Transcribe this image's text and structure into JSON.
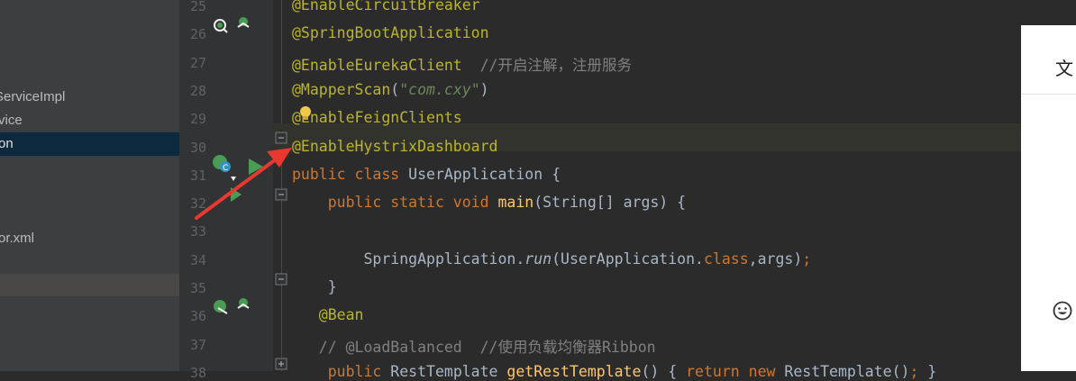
{
  "project_tree": {
    "items": [
      {
        "label": "ServiceImpl",
        "selected": false
      },
      {
        "label": "vice",
        "selected": false
      },
      {
        "label": "on",
        "selected": true
      },
      {
        "label": "or.xml",
        "selected": false
      },
      {
        "label": "",
        "selected": false,
        "highlight": true
      }
    ]
  },
  "editor": {
    "lines": [
      {
        "num": "25",
        "tokens": [
          {
            "t": "@EnableCircuitBreaker",
            "c": "ann"
          }
        ]
      },
      {
        "num": "26",
        "tokens": [
          {
            "t": "@SpringBootApplication",
            "c": "ann"
          }
        ]
      },
      {
        "num": "27",
        "tokens": [
          {
            "t": "@EnableEurekaClient",
            "c": "ann"
          },
          {
            "t": "  //开启注解，注册服务",
            "c": "cmt"
          }
        ]
      },
      {
        "num": "28",
        "tokens": [
          {
            "t": "@MapperScan",
            "c": "ann"
          },
          {
            "t": "(",
            "c": "plain"
          },
          {
            "t": "\"com.cxy\"",
            "c": "str"
          },
          {
            "t": ")",
            "c": "plain"
          }
        ]
      },
      {
        "num": "29",
        "tokens": [
          {
            "t": "@EnableFeignClients",
            "c": "ann"
          }
        ]
      },
      {
        "num": "30",
        "tokens": [
          {
            "t": "@EnableHystrixDashboard",
            "c": "ann"
          }
        ]
      },
      {
        "num": "31",
        "tokens": [
          {
            "t": "public class ",
            "c": "kw"
          },
          {
            "t": "UserApplication {",
            "c": "plain"
          }
        ]
      },
      {
        "num": "32",
        "tokens": [
          {
            "t": "    public static void ",
            "c": "kw"
          },
          {
            "t": "main",
            "c": "method"
          },
          {
            "t": "(String[] args) {",
            "c": "plain"
          }
        ]
      },
      {
        "num": "33",
        "tokens": []
      },
      {
        "num": "34",
        "tokens": [
          {
            "t": "        SpringApplication.",
            "c": "plain"
          },
          {
            "t": "run",
            "c": "italic"
          },
          {
            "t": "(UserApplication.",
            "c": "plain"
          },
          {
            "t": "class",
            "c": "kw"
          },
          {
            "t": ",args)",
            "c": "plain"
          },
          {
            "t": ";",
            "c": "kw"
          }
        ]
      },
      {
        "num": "35",
        "tokens": [
          {
            "t": "    }",
            "c": "plain"
          }
        ]
      },
      {
        "num": "36",
        "tokens": [
          {
            "t": "   @Bean",
            "c": "ann"
          }
        ]
      },
      {
        "num": "37",
        "tokens": [
          {
            "t": "   // @LoadBalanced  //使用负载均衡器Ribbon",
            "c": "cmt"
          }
        ]
      },
      {
        "num": "38",
        "tokens": [
          {
            "t": "    public ",
            "c": "kw"
          },
          {
            "t": "RestTemplate ",
            "c": "plain"
          },
          {
            "t": "getRestTemplate",
            "c": "method"
          },
          {
            "t": "() { ",
            "c": "plain"
          },
          {
            "t": "return new ",
            "c": "kw"
          },
          {
            "t": "RestTemplate()",
            "c": "plain"
          },
          {
            "t": "; ",
            "c": "kw"
          },
          {
            "t": "}",
            "c": "plain"
          }
        ]
      }
    ]
  },
  "side_panel": {
    "title_char": "文",
    "emoji_icon": "smiley-icon"
  },
  "colors": {
    "accent_arrow": "#e8382f",
    "run_green": "#499c54",
    "selection": "#0d293e"
  }
}
